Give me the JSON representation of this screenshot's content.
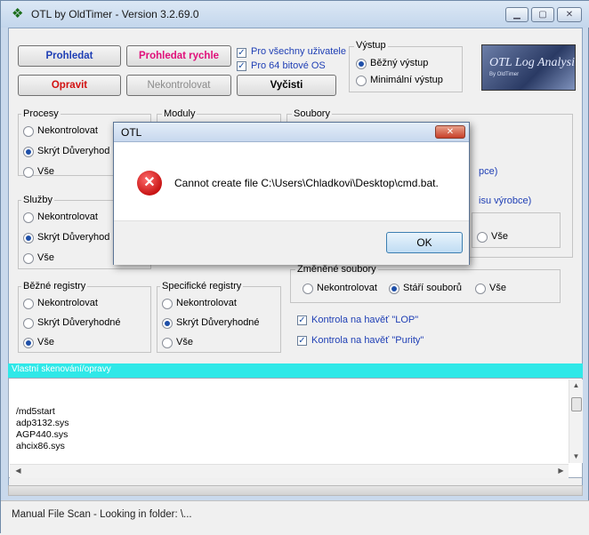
{
  "window": {
    "title": "OTL by OldTimer - Version 3.2.69.0"
  },
  "toolbar": {
    "scan": "Prohledat",
    "quick_scan": "Prohledat rychle",
    "fix": "Opravit",
    "no_check": "Nekontrolovat",
    "clean": "Vyčisti",
    "all_users": "Pro všechny uživatele",
    "x64": "Pro 64 bitové OS"
  },
  "output": {
    "title": "Výstup",
    "standard": "Běžný výstup",
    "minimal": "Minimální výstup"
  },
  "logo": {
    "text": "OTL Log Analysis",
    "sub": "By OldTimer"
  },
  "processes": {
    "title": "Procesy",
    "opt1": "Nekontrolovat",
    "opt2": "Skrýt Důveryhod",
    "opt3": "Vše"
  },
  "modules": {
    "title": "Moduly"
  },
  "files": {
    "title": "Soubory",
    "partial1": "pce)",
    "partial2": "isu výrobce)",
    "all_label": "Vše"
  },
  "services": {
    "title": "Služby",
    "opt1": "Nekontrolovat",
    "opt2": "Skrýt Důveryhod",
    "opt3": "Vše"
  },
  "changed_files": {
    "title": "Změněné soubory",
    "opt1": "Nekontrolovat",
    "opt2": "Stáří souborů",
    "opt3": "Vše",
    "lop": "Kontrola na havěť \"LOP\"",
    "purity": "Kontrola na havěť \"Purity\""
  },
  "common_registry": {
    "title": "Běžné registry",
    "opt1": "Nekontrolovat",
    "opt2": "Skrýt Důveryhodné",
    "opt3": "Vše"
  },
  "specific_registry": {
    "title": "Specifické registry",
    "opt1": "Nekontrolovat",
    "opt2": "Skrýt Důveryhodné",
    "opt3": "Vše"
  },
  "custom_scan": {
    "label": "Vlastní skenování/opravy",
    "lines": [
      "/md5start",
      "adp3132.sys",
      "AGP440.sys",
      "ahcix86.sys"
    ]
  },
  "status": {
    "text": "Manual File Scan - Looking in folder: \\..."
  },
  "dialog": {
    "title": "OTL",
    "message": "Cannot create file C:\\Users\\Chladkovi\\Desktop\\cmd.bat.",
    "ok": "OK"
  }
}
